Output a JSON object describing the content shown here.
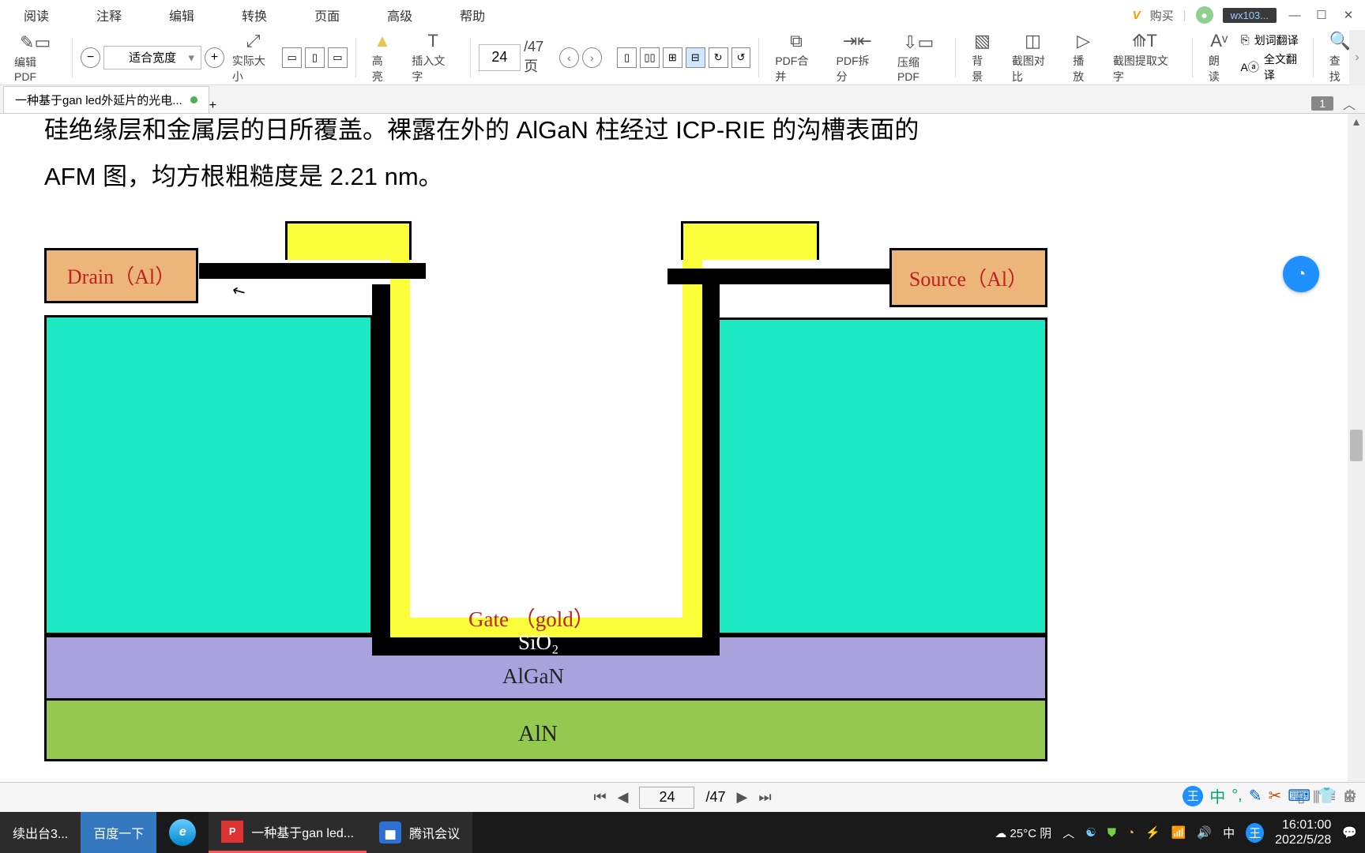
{
  "menu": {
    "read": "阅读",
    "annot": "注释",
    "edit": "编辑",
    "convert": "转换",
    "page": "页面",
    "adv": "高级",
    "help": "帮助"
  },
  "userbar": {
    "buy": "购买",
    "user": "wx103..."
  },
  "toolbar": {
    "editpdf": "编辑PDF",
    "actual": "实际大小",
    "zoomsel": "适合宽度",
    "highlight": "高亮",
    "insertText": "插入文字",
    "page": "24",
    "total": "/47页",
    "merge": "PDF合并",
    "split": "PDF拆分",
    "compress": "压缩PDF",
    "bg": "背景",
    "compare": "截图对比",
    "play": "播放",
    "extract": "截图提取文字",
    "read": "朗读",
    "seltrans": "划词翻译",
    "alltrans": "全文翻译",
    "find": "查找"
  },
  "tab": {
    "name": "一种基于gan led外延片的光电...",
    "badge": "1"
  },
  "doc": {
    "line1": "硅绝缘层和金属层的日所覆盖。裸露在外的 AlGaN 柱经过 ICP-RIE 的沟槽表面的",
    "line2": "AFM 图，均方根粗糙度是 2.21 nm。"
  },
  "dgm": {
    "drain": "Drain（Al）",
    "source": "Source（Al）",
    "gate": "Gate （gold）",
    "sio2": "SiO₂",
    "algan": "AlGaN",
    "aln": "AlN"
  },
  "pagenav": {
    "page": "24",
    "total": "/47"
  },
  "taskbar": {
    "t1": "续出台3...",
    "t2": "百度一下",
    "t3": "一种基于gan led...",
    "t4": "腾讯会议",
    "weather": "25°C  阴",
    "ime": "中",
    "time": "16:01:00",
    "date": "2022/5/28"
  }
}
